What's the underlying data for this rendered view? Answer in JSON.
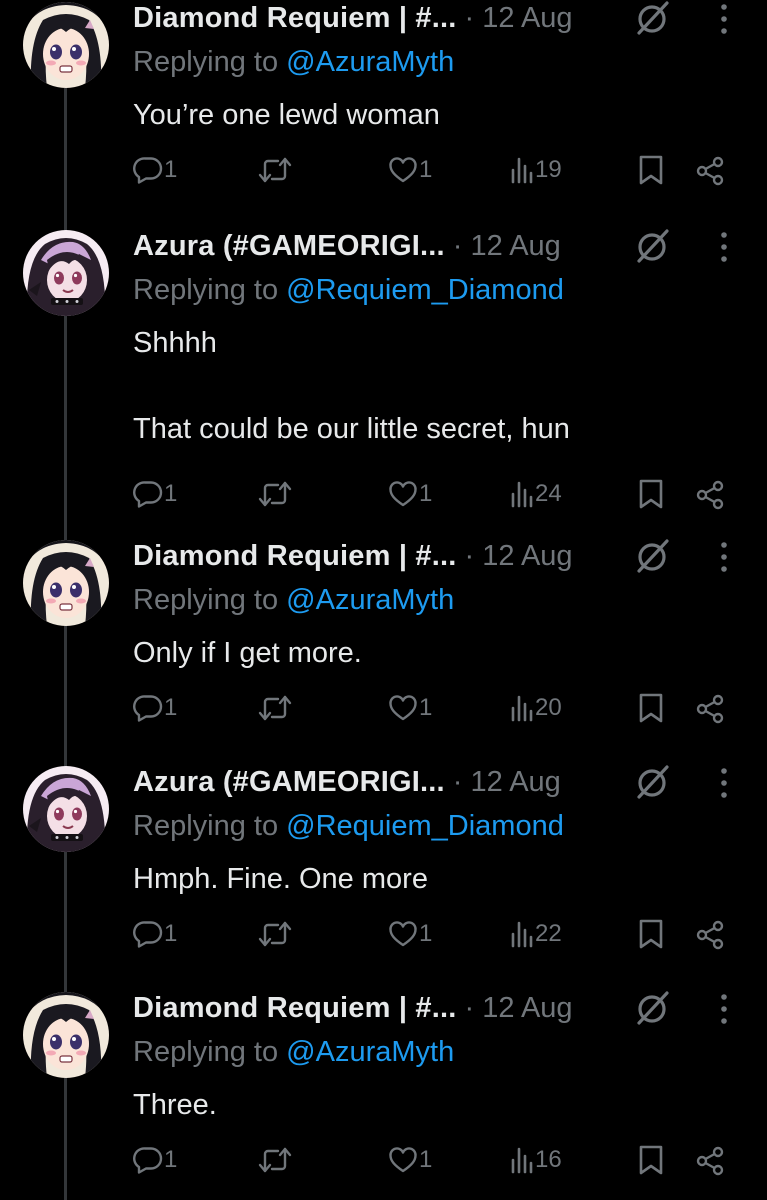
{
  "tweets": [
    {
      "author": "Diamond Requiem | #...",
      "date": "· 12 Aug",
      "reply_prefix": "Replying to",
      "reply_handle": "@AzuraMyth",
      "text": [
        "You’re one lewd woman"
      ],
      "replies": "1",
      "likes": "1",
      "views": "19",
      "avatar": "diamond"
    },
    {
      "author": "Azura (#GAMEORIGI...",
      "date": "· 12 Aug",
      "reply_prefix": "Replying to",
      "reply_handle": "@Requiem_Diamond",
      "text": [
        "Shhhh",
        "",
        "That could be our little secret, hun"
      ],
      "replies": "1",
      "likes": "1",
      "views": "24",
      "avatar": "azura"
    },
    {
      "author": "Diamond Requiem | #...",
      "date": "· 12 Aug",
      "reply_prefix": "Replying to",
      "reply_handle": "@AzuraMyth",
      "text": [
        "Only if I get more."
      ],
      "replies": "1",
      "likes": "1",
      "views": "20",
      "avatar": "diamond"
    },
    {
      "author": "Azura (#GAMEORIGI...",
      "date": "· 12 Aug",
      "reply_prefix": "Replying to",
      "reply_handle": "@Requiem_Diamond",
      "text": [
        "Hmph. Fine. One more"
      ],
      "replies": "1",
      "likes": "1",
      "views": "22",
      "avatar": "azura"
    },
    {
      "author": "Diamond Requiem | #...",
      "date": "· 12 Aug",
      "reply_prefix": "Replying to",
      "reply_handle": "@AzuraMyth",
      "text": [
        "Three."
      ],
      "replies": "1",
      "likes": "1",
      "views": "16",
      "avatar": "diamond"
    }
  ],
  "icons": {
    "reply": "reply-icon",
    "retweet": "retweet-icon",
    "like": "like-icon",
    "views": "views-icon",
    "bookmark": "bookmark-icon",
    "share": "share-icon",
    "grok": "grok-icon",
    "more": "more-icon"
  },
  "colors": {
    "background": "#000000",
    "text": "#e7e9ea",
    "muted": "#71767b",
    "link": "#1d9bf0",
    "thread_line": "#333639"
  }
}
